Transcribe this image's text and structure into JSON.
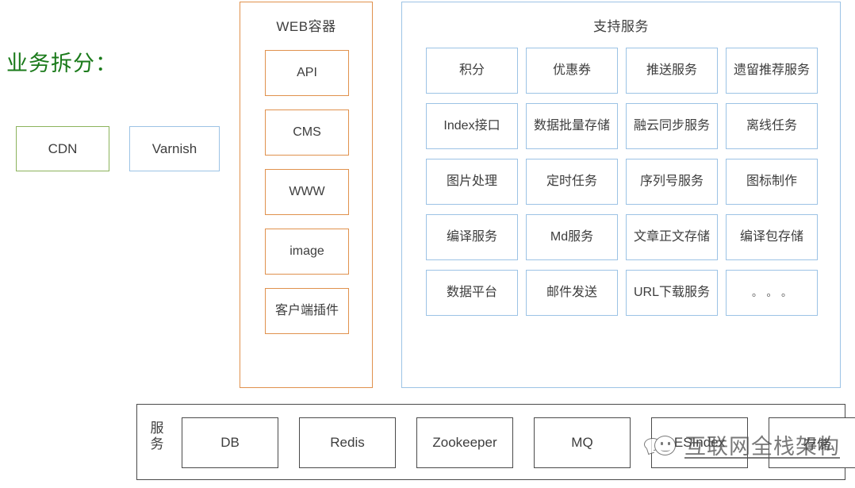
{
  "title": "业务拆分：",
  "title_color": "#1a7a1a",
  "edge": {
    "cdn": {
      "label": "CDN",
      "border_color": "#8cb35c"
    },
    "varnish": {
      "label": "Varnish",
      "border_color": "#9cc3e5"
    }
  },
  "web_container": {
    "title": "WEB容器",
    "border_color": "#e0914d",
    "items": [
      {
        "label": "API"
      },
      {
        "label": "CMS"
      },
      {
        "label": "WWW"
      },
      {
        "label": "image"
      },
      {
        "label": "客户端插件"
      }
    ]
  },
  "support_services": {
    "title": "支持服务",
    "border_color": "#9cc3e5",
    "items": [
      {
        "label": "积分"
      },
      {
        "label": "优惠券"
      },
      {
        "label": "推送服务"
      },
      {
        "label": "遗留推荐服务"
      },
      {
        "label": "Index接口"
      },
      {
        "label": "数据批量存储"
      },
      {
        "label": "融云同步服务"
      },
      {
        "label": "离线任务"
      },
      {
        "label": "图片处理"
      },
      {
        "label": "定时任务"
      },
      {
        "label": "序列号服务"
      },
      {
        "label": "图标制作"
      },
      {
        "label": "编译服务"
      },
      {
        "label": "Md服务"
      },
      {
        "label": "文章正文存储"
      },
      {
        "label": "编译包存储"
      },
      {
        "label": "数据平台"
      },
      {
        "label": "邮件发送"
      },
      {
        "label": "URL下载服务"
      },
      {
        "label": "。。。"
      }
    ]
  },
  "infrastructure": {
    "label": "服务",
    "border_color": "#4a4a4a",
    "items": [
      {
        "label": "DB"
      },
      {
        "label": "Redis"
      },
      {
        "label": "Zookeeper"
      },
      {
        "label": "MQ"
      },
      {
        "label": "ESIndex"
      },
      {
        "label": "存储"
      }
    ]
  },
  "watermark": {
    "text": "互联网全栈架构",
    "logo_icon": "smiley-chat-bubble-icon"
  }
}
